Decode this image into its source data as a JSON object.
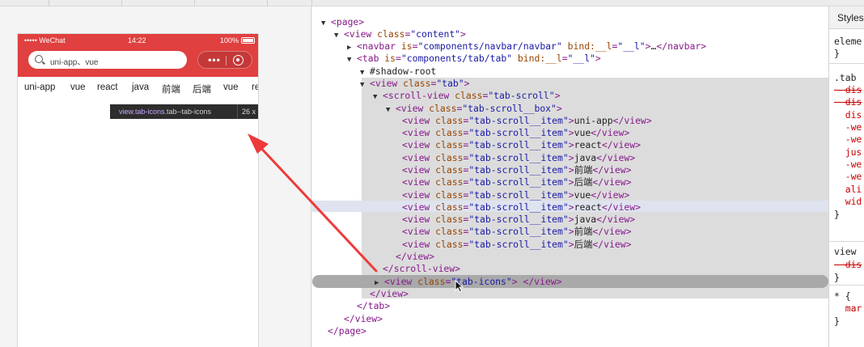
{
  "simulator": {
    "status": {
      "carrier": "••••• WeChat",
      "time": "14:22",
      "battery": "100%"
    },
    "search": {
      "placeholder": "uni-app、vue"
    },
    "capsule": {
      "dots": "•••"
    },
    "tabs": [
      "uni-app",
      "vue",
      "react",
      "java",
      "前端",
      "后端",
      "vue",
      "re"
    ],
    "tooltip": {
      "selector_main": "view.tab-icons",
      "selector_rest": ".tab--tab-icons",
      "size": "26 x"
    }
  },
  "elements": {
    "lines": [
      [
        {
          "t": "tw",
          "v": "▼"
        },
        {
          "t": "tag",
          "v": "<page>"
        }
      ],
      [
        {
          "t": "tw",
          "v": "▼"
        },
        {
          "t": "tag",
          "v": "<view "
        },
        {
          "t": "an",
          "v": "class"
        },
        {
          "t": "tag",
          "v": "="
        },
        {
          "t": "av",
          "v": "\"content\""
        },
        {
          "t": "tag",
          "v": ">"
        }
      ],
      [
        {
          "t": "tw",
          "v": "▶"
        },
        {
          "t": "tag",
          "v": "<navbar "
        },
        {
          "t": "an",
          "v": "is"
        },
        {
          "t": "tag",
          "v": "="
        },
        {
          "t": "av",
          "v": "\"components/navbar/navbar\""
        },
        {
          "t": "tag",
          "v": " "
        },
        {
          "t": "an",
          "v": "bind:__l"
        },
        {
          "t": "tag",
          "v": "="
        },
        {
          "t": "av",
          "v": "\"__l\""
        },
        {
          "t": "tag",
          "v": ">"
        },
        {
          "t": "tx",
          "v": "…"
        },
        {
          "t": "tag",
          "v": "</navbar>"
        }
      ],
      [
        {
          "t": "tw",
          "v": "▼"
        },
        {
          "t": "tag",
          "v": "<tab "
        },
        {
          "t": "an",
          "v": "is"
        },
        {
          "t": "tag",
          "v": "="
        },
        {
          "t": "av",
          "v": "\"components/tab/tab\""
        },
        {
          "t": "tag",
          "v": " "
        },
        {
          "t": "an",
          "v": "bind:__l"
        },
        {
          "t": "tag",
          "v": "="
        },
        {
          "t": "av",
          "v": "\"__l\""
        },
        {
          "t": "tag",
          "v": ">"
        }
      ],
      [
        {
          "t": "tw",
          "v": "▼"
        },
        {
          "t": "tx",
          "v": "#shadow-root"
        }
      ],
      [
        {
          "t": "tw",
          "v": "▼"
        },
        {
          "t": "tag",
          "v": "<view "
        },
        {
          "t": "an",
          "v": "class"
        },
        {
          "t": "tag",
          "v": "="
        },
        {
          "t": "av",
          "v": "\"tab\""
        },
        {
          "t": "tag",
          "v": ">"
        }
      ],
      [
        {
          "t": "tw",
          "v": "▼"
        },
        {
          "t": "tag",
          "v": "<scroll-view "
        },
        {
          "t": "an",
          "v": "class"
        },
        {
          "t": "tag",
          "v": "="
        },
        {
          "t": "av",
          "v": "\"tab-scroll\""
        },
        {
          "t": "tag",
          "v": ">"
        }
      ],
      [
        {
          "t": "tw",
          "v": "▼"
        },
        {
          "t": "tag",
          "v": "<view "
        },
        {
          "t": "an",
          "v": "class"
        },
        {
          "t": "tag",
          "v": "="
        },
        {
          "t": "av",
          "v": "\"tab-scroll__box\""
        },
        {
          "t": "tag",
          "v": ">"
        }
      ],
      [
        {
          "t": "tag",
          "v": "<view "
        },
        {
          "t": "an",
          "v": "class"
        },
        {
          "t": "tag",
          "v": "="
        },
        {
          "t": "av",
          "v": "\"tab-scroll__item\""
        },
        {
          "t": "tag",
          "v": ">"
        },
        {
          "t": "tx",
          "v": "uni-app"
        },
        {
          "t": "tag",
          "v": "</view>"
        }
      ],
      [
        {
          "t": "tag",
          "v": "<view "
        },
        {
          "t": "an",
          "v": "class"
        },
        {
          "t": "tag",
          "v": "="
        },
        {
          "t": "av",
          "v": "\"tab-scroll__item\""
        },
        {
          "t": "tag",
          "v": ">"
        },
        {
          "t": "tx",
          "v": "vue"
        },
        {
          "t": "tag",
          "v": "</view>"
        }
      ],
      [
        {
          "t": "tag",
          "v": "<view "
        },
        {
          "t": "an",
          "v": "class"
        },
        {
          "t": "tag",
          "v": "="
        },
        {
          "t": "av",
          "v": "\"tab-scroll__item\""
        },
        {
          "t": "tag",
          "v": ">"
        },
        {
          "t": "tx",
          "v": "react"
        },
        {
          "t": "tag",
          "v": "</view>"
        }
      ],
      [
        {
          "t": "tag",
          "v": "<view "
        },
        {
          "t": "an",
          "v": "class"
        },
        {
          "t": "tag",
          "v": "="
        },
        {
          "t": "av",
          "v": "\"tab-scroll__item\""
        },
        {
          "t": "tag",
          "v": ">"
        },
        {
          "t": "tx",
          "v": "java"
        },
        {
          "t": "tag",
          "v": "</view>"
        }
      ],
      [
        {
          "t": "tag",
          "v": "<view "
        },
        {
          "t": "an",
          "v": "class"
        },
        {
          "t": "tag",
          "v": "="
        },
        {
          "t": "av",
          "v": "\"tab-scroll__item\""
        },
        {
          "t": "tag",
          "v": ">"
        },
        {
          "t": "tx",
          "v": "前端"
        },
        {
          "t": "tag",
          "v": "</view>"
        }
      ],
      [
        {
          "t": "tag",
          "v": "<view "
        },
        {
          "t": "an",
          "v": "class"
        },
        {
          "t": "tag",
          "v": "="
        },
        {
          "t": "av",
          "v": "\"tab-scroll__item\""
        },
        {
          "t": "tag",
          "v": ">"
        },
        {
          "t": "tx",
          "v": "后端"
        },
        {
          "t": "tag",
          "v": "</view>"
        }
      ],
      [
        {
          "t": "tag",
          "v": "<view "
        },
        {
          "t": "an",
          "v": "class"
        },
        {
          "t": "tag",
          "v": "="
        },
        {
          "t": "av",
          "v": "\"tab-scroll__item\""
        },
        {
          "t": "tag",
          "v": ">"
        },
        {
          "t": "tx",
          "v": "vue"
        },
        {
          "t": "tag",
          "v": "</view>"
        }
      ],
      [
        {
          "t": "tag",
          "v": "<view "
        },
        {
          "t": "an",
          "v": "class"
        },
        {
          "t": "tag",
          "v": "="
        },
        {
          "t": "av",
          "v": "\"tab-scroll__item\""
        },
        {
          "t": "tag",
          "v": ">"
        },
        {
          "t": "tx",
          "v": "react"
        },
        {
          "t": "tag",
          "v": "</view>"
        }
      ],
      [
        {
          "t": "tag",
          "v": "<view "
        },
        {
          "t": "an",
          "v": "class"
        },
        {
          "t": "tag",
          "v": "="
        },
        {
          "t": "av",
          "v": "\"tab-scroll__item\""
        },
        {
          "t": "tag",
          "v": ">"
        },
        {
          "t": "tx",
          "v": "java"
        },
        {
          "t": "tag",
          "v": "</view>"
        }
      ],
      [
        {
          "t": "tag",
          "v": "<view "
        },
        {
          "t": "an",
          "v": "class"
        },
        {
          "t": "tag",
          "v": "="
        },
        {
          "t": "av",
          "v": "\"tab-scroll__item\""
        },
        {
          "t": "tag",
          "v": ">"
        },
        {
          "t": "tx",
          "v": "前端"
        },
        {
          "t": "tag",
          "v": "</view>"
        }
      ],
      [
        {
          "t": "tag",
          "v": "<view "
        },
        {
          "t": "an",
          "v": "class"
        },
        {
          "t": "tag",
          "v": "="
        },
        {
          "t": "av",
          "v": "\"tab-scroll__item\""
        },
        {
          "t": "tag",
          "v": ">"
        },
        {
          "t": "tx",
          "v": "后端"
        },
        {
          "t": "tag",
          "v": "</view>"
        }
      ],
      [
        {
          "t": "tag",
          "v": "</view>"
        }
      ],
      [
        {
          "t": "tag",
          "v": "</scroll-view>"
        }
      ],
      [
        {
          "t": "tw",
          "v": "▶"
        },
        {
          "t": "tag",
          "v": "<view "
        },
        {
          "t": "an",
          "v": "class"
        },
        {
          "t": "tag",
          "v": "="
        },
        {
          "t": "av",
          "v": "\"tab-icons\""
        },
        {
          "t": "tag",
          "v": "> "
        },
        {
          "t": "tag",
          "v": "</view>"
        }
      ],
      [
        {
          "t": "tag",
          "v": "</view>"
        }
      ],
      [
        {
          "t": "tag",
          "v": "</tab>"
        }
      ],
      [
        {
          "t": "tag",
          "v": "</view>"
        }
      ],
      [
        {
          "t": "tag",
          "v": "</page>"
        }
      ]
    ]
  },
  "styles": {
    "header": "Styles",
    "rows": [
      {
        "v": "eleme",
        "c": "plain"
      },
      {
        "v": "}",
        "c": "plain"
      },
      {
        "v": ".tab",
        "c": "plain"
      },
      {
        "v": "  dis",
        "c": "strike"
      },
      {
        "v": "  dis",
        "c": "strike"
      },
      {
        "v": "  dis",
        "c": "prop"
      },
      {
        "v": "  -we",
        "c": "prop"
      },
      {
        "v": "  -we",
        "c": "prop"
      },
      {
        "v": "  jus",
        "c": "prop"
      },
      {
        "v": "  -we",
        "c": "prop"
      },
      {
        "v": "  -we",
        "c": "prop"
      },
      {
        "v": "  ali",
        "c": "prop"
      },
      {
        "v": "  wid",
        "c": "prop"
      },
      {
        "v": "}",
        "c": "plain"
      },
      {
        "v": "view",
        "c": "plain"
      },
      {
        "v": "  dis",
        "c": "strike"
      },
      {
        "v": "}",
        "c": "plain"
      },
      {
        "v": "* {",
        "c": "plain"
      },
      {
        "v": "  mar",
        "c": "prop"
      },
      {
        "v": "}",
        "c": "plain"
      }
    ]
  }
}
